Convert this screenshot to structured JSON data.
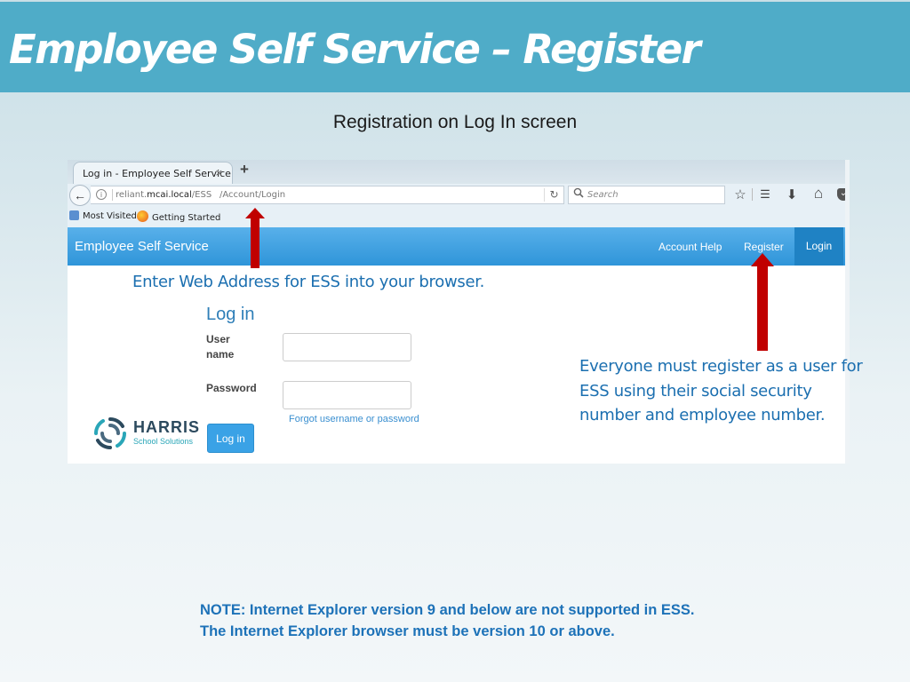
{
  "slide": {
    "title": "Employee Self Service – Register",
    "subtitle": "Registration on Log In screen",
    "callout_address": "Enter Web Address for ESS into your browser.",
    "callout_register": "Everyone must register as a user for ESS using their social security number and employee number.",
    "note_line1": "NOTE:  Internet Explorer version 9 and below are not supported in ESS.",
    "note_line2": "The Internet Explorer browser must be version 10 or above.",
    "colors": {
      "header": "#4facc8",
      "callout_text": "#1b6fb0",
      "arrow": "#c00000"
    }
  },
  "browser": {
    "tab_title": "Log in - Employee Self Service",
    "tab_close": "×",
    "new_tab": "+",
    "url_host_prefix": "reliant.",
    "url_host_domain": "mcai.local",
    "url_host_suffix": "/ESS",
    "url_path": "/Account/Login",
    "search_placeholder": "Search",
    "bookmarks": [
      {
        "label": "Most Visited"
      },
      {
        "label": "Getting Started"
      }
    ],
    "icons": {
      "back": "←",
      "info": "i",
      "reload": "↻",
      "search": "⌕",
      "bookmark_star": "☆",
      "reading_list": "☰",
      "download": "⬇",
      "home": "⌂",
      "pocket": "⌄"
    }
  },
  "app": {
    "brand": "Employee Self Service",
    "nav": {
      "account_help": "Account Help",
      "register": "Register",
      "login": "Login"
    },
    "login_form": {
      "title": "Log in",
      "username_label_1": "User",
      "username_label_2": "name",
      "username_value": "",
      "password_label": "Password",
      "password_value": "",
      "forgot_link": "Forgot username or password",
      "submit": "Log in"
    },
    "logo": {
      "name": "HARRIS",
      "tagline": "School Solutions"
    }
  }
}
